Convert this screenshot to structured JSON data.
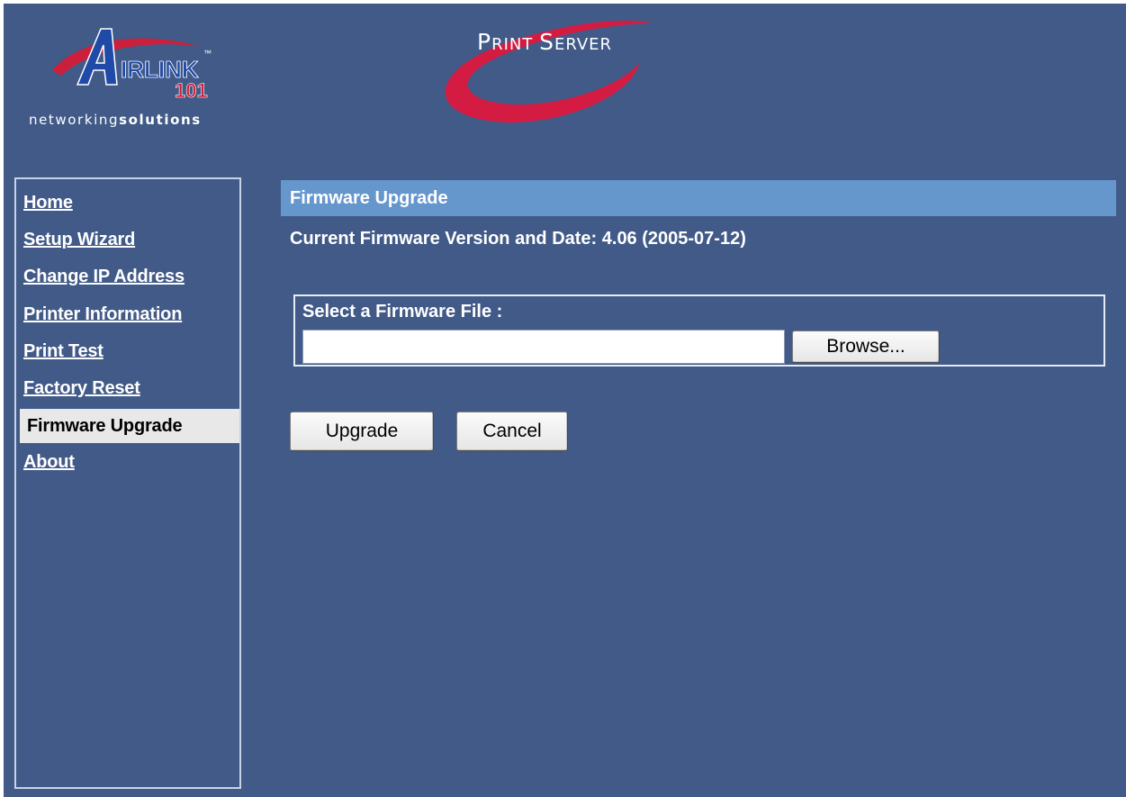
{
  "header": {
    "logo_text": "AIRLINK 101",
    "tagline_light": "networking",
    "tagline_bold": "solutions",
    "product_title_initial_1": "P",
    "product_title_rest_1": "RINT",
    "product_title_initial_2": "S",
    "product_title_rest_2": "ERVER"
  },
  "sidebar": {
    "items": [
      {
        "label": "Home",
        "active": false
      },
      {
        "label": "Setup Wizard",
        "active": false
      },
      {
        "label": "Change IP Address",
        "active": false
      },
      {
        "label": "Printer Information",
        "active": false
      },
      {
        "label": "Print Test",
        "active": false
      },
      {
        "label": "Factory Reset",
        "active": false
      },
      {
        "label": "Firmware Upgrade",
        "active": true
      },
      {
        "label": "About",
        "active": false
      }
    ]
  },
  "main": {
    "section_title": "Firmware Upgrade",
    "firmware_version_text": "Current Firmware Version and Date: 4.06 (2005-07-12)",
    "file_select": {
      "label": "Select a Firmware File :",
      "value": "",
      "browse_label": "Browse..."
    },
    "upgrade_label": "Upgrade",
    "cancel_label": "Cancel"
  },
  "colors": {
    "background": "#415a88",
    "section_bar": "#6596cc",
    "logo_red": "#cc1f3b",
    "logo_blue": "#1f4aa8",
    "active_nav_bg": "#e8e8e8"
  }
}
